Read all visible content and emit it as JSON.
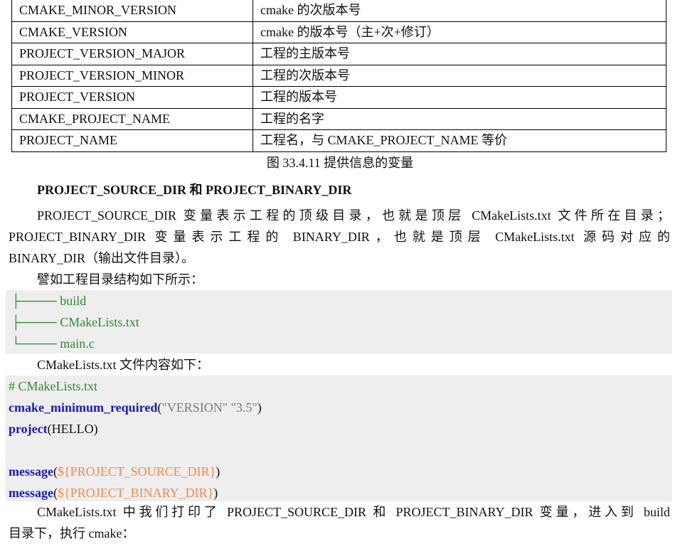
{
  "table": {
    "rows": [
      {
        "name": "CMAKE_MINOR_VERSION",
        "desc": "cmake 的次版本号"
      },
      {
        "name": "CMAKE_VERSION",
        "desc": "cmake 的版本号（主+次+修订）"
      },
      {
        "name": "PROJECT_VERSION_MAJOR",
        "desc": "工程的主版本号"
      },
      {
        "name": "PROJECT_VERSION_MINOR",
        "desc": "工程的次版本号"
      },
      {
        "name": "PROJECT_VERSION",
        "desc": "工程的版本号"
      },
      {
        "name": "CMAKE_PROJECT_NAME",
        "desc": "工程的名字"
      },
      {
        "name": "PROJECT_NAME",
        "desc": "工程名，与 CMAKE_PROJECT_NAME 等价"
      }
    ]
  },
  "caption": "图  33.4.11  提供信息的变量",
  "heading": "PROJECT_SOURCE_DIR 和 PROJECT_BINARY_DIR",
  "paragraph1": {
    "line1": "PROJECT_SOURCE_DIR 变量表示工程的顶级目录，也就是顶层 CMakeLists.txt 文件所在目录；",
    "line2": "PROJECT_BINARY_DIR 变量表示工程的 BINARY_DIR，也就是顶层 CMakeLists.txt 源码对应的",
    "line3": "BINARY_DIR（输出文件目录）。"
  },
  "paragraph2": "譬如工程目录结构如下所示：",
  "tree": [
    {
      "branch": "├──── ",
      "name": "build"
    },
    {
      "branch": "├──── ",
      "name": "CMakeLists.txt"
    },
    {
      "branch": "└──── ",
      "name": "main.c"
    }
  ],
  "paragraph3": "CMakeLists.txt 文件内容如下：",
  "code": {
    "comment": "# CMakeLists.txt",
    "line2_kw": "cmake_minimum_required",
    "line2_open": "(",
    "line2_args": "\"VERSION\" \"3.5\"",
    "line2_close": ")",
    "line3_kw": "project",
    "line3_rest": "(HELLO)",
    "line5_kw": "message",
    "line5_open": "(",
    "line5_var": "${PROJECT_SOURCE_DIR}",
    "line5_close": ")",
    "line6_kw": "message",
    "line6_open": "(",
    "line6_var": "${PROJECT_BINARY_DIR}",
    "line6_close": ")"
  },
  "paragraph4": {
    "line1": "CMakeLists.txt 中我们打印了 PROJECT_SOURCE_DIR 和 PROJECT_BINARY_DIR 变量，进入到 build",
    "line2": "目录下，执行 cmake："
  },
  "colors": {
    "comment_green": "#2e8b2e",
    "keyword_blue": "#1a1ab8",
    "string_gray": "#7a7a7a",
    "variable_orange": "#f08a4b",
    "code_background": "#eeeeee"
  }
}
